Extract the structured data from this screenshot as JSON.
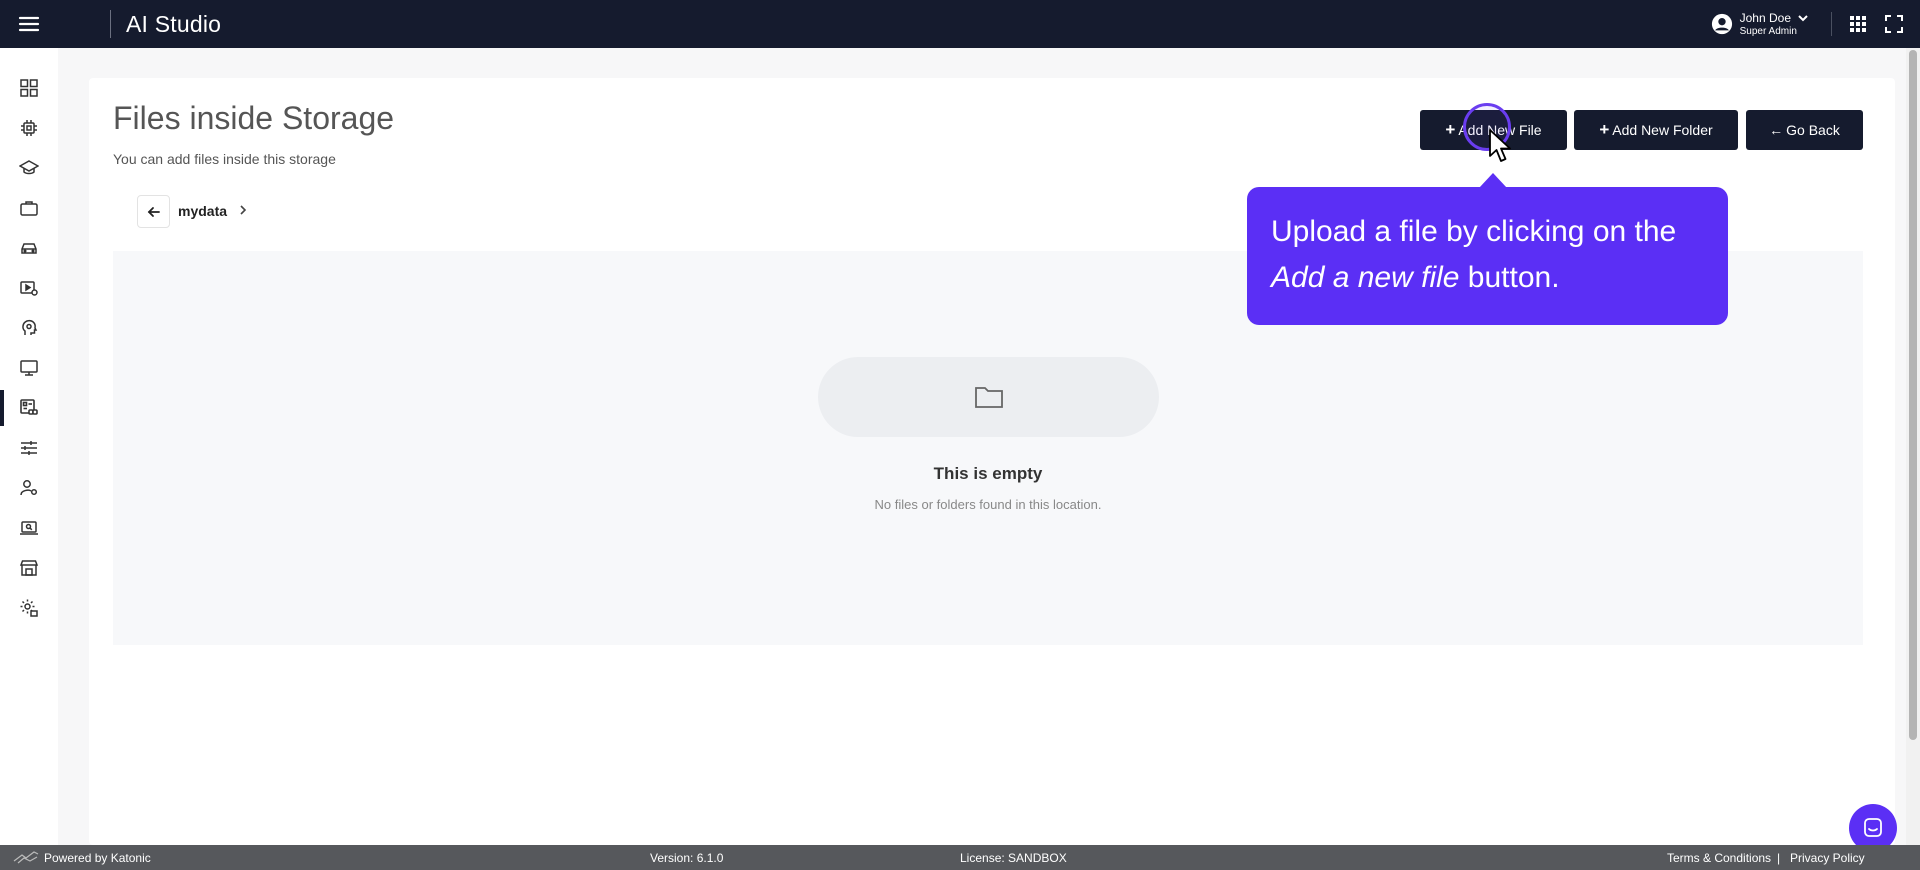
{
  "app": {
    "title": "AI Studio"
  },
  "user": {
    "name": "John Doe",
    "role": "Super Admin"
  },
  "page": {
    "title": "Files inside Storage",
    "subtitle": "You can add files inside this storage",
    "buttons": {
      "add_file": "Add New File",
      "add_folder": "Add New Folder",
      "go_back": "Go Back"
    },
    "breadcrumb": {
      "current": "mydata"
    },
    "empty": {
      "title": "This is empty",
      "message": "No files or folders found in this location."
    }
  },
  "tooltip": {
    "before": "Upload a file by clicking on the ",
    "emphasis": "Add a new file",
    "after": " button."
  },
  "sidebar": {
    "items": [
      {
        "icon": "dashboard-icon"
      },
      {
        "icon": "chip-icon"
      },
      {
        "icon": "graduation-cap-icon"
      },
      {
        "icon": "briefcase-icon"
      },
      {
        "icon": "car-icon"
      },
      {
        "icon": "video-settings-icon"
      },
      {
        "icon": "head-settings-icon"
      },
      {
        "icon": "monitor-icon"
      },
      {
        "icon": "storage-link-icon",
        "active": true
      },
      {
        "icon": "sliders-icon"
      },
      {
        "icon": "user-settings-icon"
      },
      {
        "icon": "laptop-search-icon"
      },
      {
        "icon": "store-icon"
      },
      {
        "icon": "gear-lock-icon"
      }
    ]
  },
  "footer": {
    "powered_by": "Powered by Katonic",
    "version": "Version: 6.1.0",
    "license": "License: SANDBOX",
    "terms": "Terms & Conditions",
    "separator": "|",
    "privacy": "Privacy Policy"
  },
  "colors": {
    "topbar": "#151b2e",
    "accent": "#5b2ff5",
    "button": "#151b2e",
    "footer": "#56585c"
  }
}
